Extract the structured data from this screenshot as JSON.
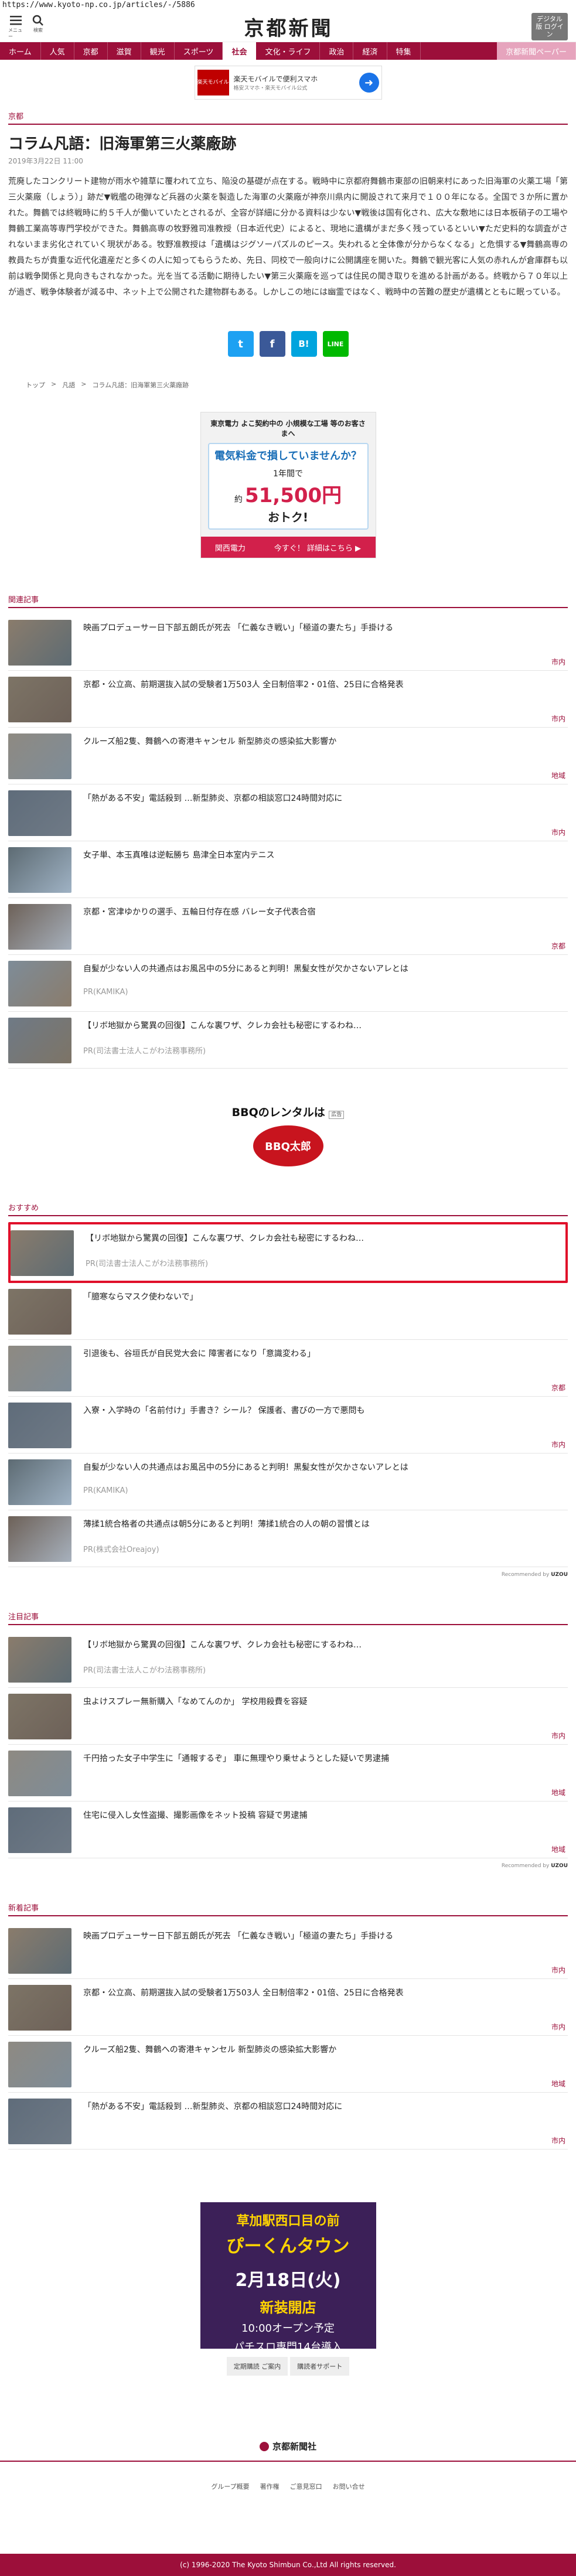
{
  "browser": {
    "url": "https://www.kyoto-np.co.jp/articles/-/5886"
  },
  "header": {
    "menu_label": "メニュー",
    "search_label": "検索",
    "logo": "京都新聞",
    "digital_button": "デジタル版 ログイン"
  },
  "nav": {
    "items": [
      "ホーム",
      "人気",
      "京都",
      "滋賀",
      "観光",
      "スポーツ",
      "社会",
      "文化・ライフ",
      "政治",
      "経済",
      "特集"
    ],
    "paper_label": "京都新聞ペーパー"
  },
  "top_ad": {
    "brand": "楽天モバイル",
    "line1": "楽天モバイルで便利スマホ",
    "line2": "格安スマホ・楽天モバイル公式"
  },
  "article": {
    "section": "京都",
    "title": "コラム凡語：旧海軍第三火薬廠跡",
    "date": "2019年3月22日 11:00",
    "body": "荒廃したコンクリート建物が雨水や雑草に覆われて立ち、陥没の基礎が点在する。戦時中に京都府舞鶴市東部の旧朝来村にあった旧海軍の火薬工場「第三火薬廠（しょう）」跡だ▼戦艦の砲弾など兵器の火薬を製造した海軍の火薬廠が神奈川県内に開設されて来月で１００年になる。全国で３か所に置かれた。舞鶴では終戦時に約５千人が働いていたとされるが、全容が詳細に分かる資料は少ない▼戦後は国有化され、広大な敷地には日本板硝子の工場や舞鶴工業高等専門学校ができた。舞鶴高専の牧野雅司准教授（日本近代史）によると、現地に遺構がまだ多く残っているといい▼ただ史料的な調査がされないまま劣化されていく現状がある。牧野准教授は「遺構はジグソーパズルのピース。失われると全体像が分からなくなる」と危惧する▼舞鶴高専の教員たちが貴重な近代化遺産だと多くの人に知ってもらうため、先日、同校で一般向けに公開講座を開いた。舞鶴で観光客に人気の赤れんが倉庫群も以前は戦争関係と見向きもされなかった。光を当てる活動に期待したい▼第三火薬廠を巡っては住民の聞き取りを進める計画がある。終戦から７０年以上が過ぎ、戦争体験者が減る中、ネット上で公開された建物群もある。しかしこの地には幽霊ではなく、戦時中の苦難の歴史が遺構とともに眠っている。"
  },
  "share": {
    "twitter": "t",
    "facebook": "f",
    "hatena": "B!",
    "line": "LINE"
  },
  "breadcrumb": [
    "トップ",
    ">",
    "凡語",
    ">",
    "コラム凡語：旧海軍第三火薬廠跡"
  ],
  "mid_ad": {
    "head": "東京電力 よこ契約中の 小規模な工場 等のお客さまへ",
    "q": "電気料金で損していませんか？",
    "annual": "1年間で",
    "about": "約",
    "amount": "51,500円",
    "deal": "おトク!",
    "brand": "関西電力",
    "cta": "今すぐ！ 詳細はこちら ▶"
  },
  "related": {
    "heading": "関連記事",
    "items": [
      {
        "title": "映画プロデューサー日下部五朗氏が死去 「仁義なき戦い」「極道の妻たち」手掛ける",
        "pr": "",
        "cat": "市内"
      },
      {
        "title": "京都・公立高、前期選抜入試の受験者1万503人 全日制倍率2・01倍、25日に合格発表",
        "pr": "",
        "cat": "市内"
      },
      {
        "title": "クルーズ船2隻、舞鶴への寄港キャンセル 新型肺炎の感染拡大影響か",
        "pr": "",
        "cat": "地域"
      },
      {
        "title": "「熱がある不安」電話殺到 …新型肺炎、京都の相談窓口24時間対応に",
        "pr": "",
        "cat": "市内"
      },
      {
        "title": "女子単、本玉真唯は逆転勝ち 島津全日本室内テニス",
        "pr": "",
        "cat": ""
      },
      {
        "title": "京都・宮津ゆかりの選手、五輪日付存在感 バレー女子代表合宿",
        "pr": "",
        "cat": "京都"
      },
      {
        "title": "自髪が少ない人の共通点はお風呂中の5分にあると判明！黒髪女性が欠かさないアレとは",
        "pr": "PR(KAMIKA)",
        "cat": ""
      },
      {
        "title": "【リボ地獄から驚異の回復】こんな裏ワザ、クレカ会社も秘密にするわね…",
        "pr": "PR(司法書士法人こがわ法務事務所)",
        "cat": ""
      }
    ]
  },
  "bbq_ad": {
    "title": "BBQのレンタルは",
    "brand": "BBQ太郎",
    "ad_label": "広告"
  },
  "recommend": {
    "heading": "おすすめ",
    "items": [
      {
        "title": "【リボ地獄から驚異の回復】こんな裏ワザ、クレカ会社も秘密にするわね…",
        "pr": "PR(司法書士法人こがわ法務事務所)",
        "cat": ""
      },
      {
        "title": "「臆寒ならマスク使わないで」",
        "pr": "",
        "cat": ""
      },
      {
        "title": "引退後も、谷垣氏が自民党大会に 障害者になり「意識変わる」",
        "pr": "",
        "cat": "京都"
      },
      {
        "title": "入寮・入学時の「名前付け」手書き？シール？ 保護者、書びの一方で悪問も",
        "pr": "",
        "cat": "市内"
      },
      {
        "title": "自髪が少ない人の共通点はお風呂中の5分にあると判明！黒髪女性が欠かさないアレとは",
        "pr": "PR(KAMIKA)",
        "cat": ""
      },
      {
        "title": "薄揉1統合格者の共通点は朝5分にあると判明！薄揉1統合の人の朝の習慣とは",
        "pr": "PR(株式会社Oreajoy)",
        "cat": ""
      }
    ],
    "credit_prefix": "Recommended by",
    "credit_brand": "UZOU"
  },
  "attention": {
    "heading": "注目記事",
    "items": [
      {
        "title": "【リボ地獄から驚異の回復】こんな裏ワザ、クレカ会社も秘密にするわね…",
        "pr": "PR(司法書士法人こがわ法務事務所)",
        "cat": ""
      },
      {
        "title": "虫よけスプレー無新購入「なめてんのか」 学校用殺費を容疑",
        "pr": "",
        "cat": "市内"
      },
      {
        "title": "千円拾った女子中学生に「通報するぞ」 車に無理やり乗せようとした疑いで男逮捕",
        "pr": "",
        "cat": "地域"
      },
      {
        "title": "住宅に侵入し女性盗撮、撮影画像をネット投稿 容疑で男逮捕",
        "pr": "",
        "cat": "地域"
      }
    ],
    "credit_prefix": "Recommended by",
    "credit_brand": "UZOU"
  },
  "latest": {
    "heading": "新着記事",
    "items": [
      {
        "title": "映画プロデューサー日下部五朗氏が死去 「仁義なき戦い」「極道の妻たち」手掛ける",
        "cat": "市内"
      },
      {
        "title": "京都・公立高、前期選抜入試の受験者1万503人 全日制倍率2・01倍、25日に合格発表",
        "cat": "市内"
      },
      {
        "title": "クルーズ船2隻、舞鶴への寄港キャンセル 新型肺炎の感染拡大影響か",
        "cat": "地域"
      },
      {
        "title": "「熱がある不安」電話殺到 …新型肺炎、京都の相談窓口24時間対応に",
        "cat": "市内"
      }
    ]
  },
  "bottom_ad": {
    "l1": "草加駅西口目の前",
    "l2": "ぴーくんタウン",
    "l3": "2月18日(火)",
    "l4": "新装開店",
    "l5": "10:00オープン予定",
    "l6": "パチスロ専門14台導入"
  },
  "footer": {
    "links": [
      "定期購読 ご案内",
      "購読者サポート"
    ],
    "logo": "京都新聞社",
    "nav": [
      "グループ概要",
      "著作権",
      "ご意見窓口",
      "お問い合せ"
    ],
    "copyright": "(c) 1996-2020 The Kyoto Shimbun Co.,Ltd All rights reserved."
  },
  "colors": {
    "brand": "#9c0f3a",
    "highlight": "#e0102a"
  }
}
